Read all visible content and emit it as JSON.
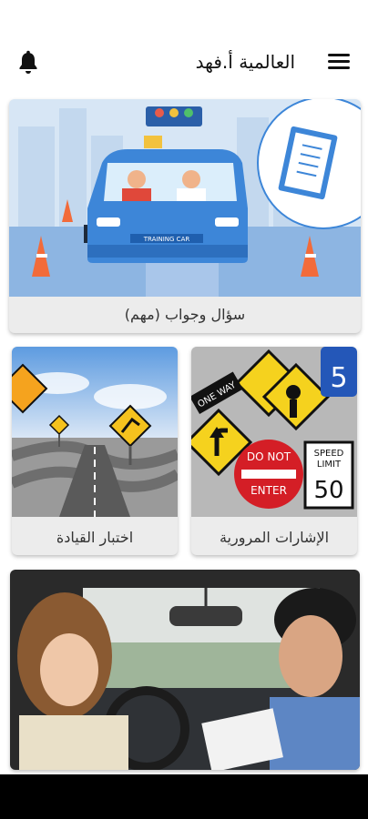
{
  "header": {
    "title": "العالمية أ.فهد",
    "menu_icon": "hamburger-menu-icon",
    "bell_icon": "bell-icon"
  },
  "cards": {
    "qa": {
      "label": "سؤال وجواب (مهم)"
    },
    "signs": {
      "label": "الإشارات المرورية"
    },
    "driving_test": {
      "label": "اختبار القيادة"
    }
  },
  "images": {
    "qa": {
      "car_plate": "TRAINING CAR"
    },
    "signs": {
      "one_way": "ONE WAY",
      "do_not_enter_top": "DO NOT",
      "do_not_enter_bottom": "ENTER",
      "speed_limit_top": "SPEED",
      "speed_limit_mid": "LIMIT",
      "speed_limit_value": "50",
      "route_number": "5"
    }
  },
  "colors": {
    "bar": "#000000",
    "card_bg": "#ececec",
    "car_blue": "#3d86d8"
  }
}
